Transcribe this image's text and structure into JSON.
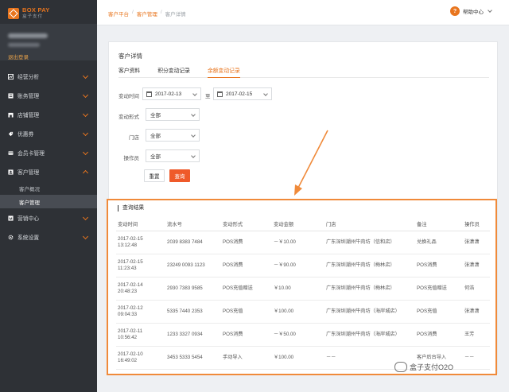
{
  "brand": {
    "logo_main": "BOX PAY",
    "logo_sub": "盒子支付"
  },
  "sidebar": {
    "logout_label": "退出登录",
    "items": [
      {
        "label": "经营分析",
        "icon": "chart-icon"
      },
      {
        "label": "账务管理",
        "icon": "ledger-icon"
      },
      {
        "label": "店铺管理",
        "icon": "store-icon"
      },
      {
        "label": "优惠券",
        "icon": "coupon-icon"
      },
      {
        "label": "会员卡管理",
        "icon": "card-icon"
      },
      {
        "label": "客户管理",
        "icon": "customer-icon",
        "expanded": true,
        "children": [
          {
            "label": "客户概况"
          },
          {
            "label": "客户管理",
            "active": true
          }
        ]
      },
      {
        "label": "营销中心",
        "icon": "marketing-icon"
      },
      {
        "label": "系统设置",
        "icon": "gear-icon"
      }
    ]
  },
  "breadcrumb": {
    "c1": "客户平台",
    "c2": "客户管理",
    "c3": "客户详情",
    "sep": "/"
  },
  "header": {
    "help_label": "帮助中心",
    "help_icon_text": "?"
  },
  "detail": {
    "title": "客户详情",
    "tabs": [
      {
        "label": "客户资料"
      },
      {
        "label": "积分变动记录"
      },
      {
        "label": "余额变动记录",
        "active": true
      }
    ]
  },
  "filters": {
    "time_label": "变动时间",
    "date_from": "2017-02-13",
    "to_label": "至",
    "date_to": "2017-02-15",
    "type_label": "变动形式",
    "type_value": "全部",
    "store_label": "门店",
    "store_value": "全部",
    "operator_label": "操作员",
    "operator_value": "全部",
    "reset_label": "重置",
    "query_label": "查询"
  },
  "results": {
    "title": "查询结果",
    "columns": [
      "变动时间",
      "流水号",
      "变动形式",
      "变动金额",
      "门店",
      "备注",
      "操作员"
    ],
    "rows": [
      {
        "time": "2017-02-15\n13:12:48",
        "serial": "2039 8383 7484",
        "type": "POS消费",
        "amount": "－￥10.00",
        "store": "广东深圳潮州牛肉坊（信和店）",
        "note": "兑换礼品",
        "operator": "张潇潇"
      },
      {
        "time": "2017-02-15\n11:23:43",
        "serial": "23249 0093 1123",
        "type": "POS消费",
        "amount": "－￥90.00",
        "store": "广东深圳潮州牛肉坊（梅林店）",
        "note": "POS消费",
        "operator": "张潇潇"
      },
      {
        "time": "2017-02-14\n20:48:23",
        "serial": "2930 7383 9585",
        "type": "POS充值赠送",
        "amount": "￥10.00",
        "store": "广东深圳潮州牛肉坊（梅林店）",
        "note": "POS充值赠送",
        "operator": "何浩"
      },
      {
        "time": "2017-02-12\n09:04:33",
        "serial": "5335 7440 2353",
        "type": "POS充值",
        "amount": "￥100.00",
        "store": "广东深圳潮州牛肉坊（海岸城店）",
        "note": "POS充值",
        "operator": "张潇潇"
      },
      {
        "time": "2017-02-11\n10:56:42",
        "serial": "1233 3327 0934",
        "type": "POS消费",
        "amount": "－￥50.00",
        "store": "广东深圳潮州牛肉坊（海岸城店）",
        "note": "POS消费",
        "operator": "王芳"
      },
      {
        "time": "2017-02-10\n16:49:02",
        "serial": "3453 5333 5454",
        "type": "手动导入",
        "amount": "￥100.00",
        "store": "－－",
        "note": "客户后台导入",
        "operator": "－－"
      }
    ]
  },
  "watermark": {
    "text": "盒子支付O2O"
  },
  "colors": {
    "accent": "#e8751e",
    "sidebar_bg": "#2e3136",
    "highlight_border": "#f08a3a",
    "query_button": "#ef5a2a"
  }
}
